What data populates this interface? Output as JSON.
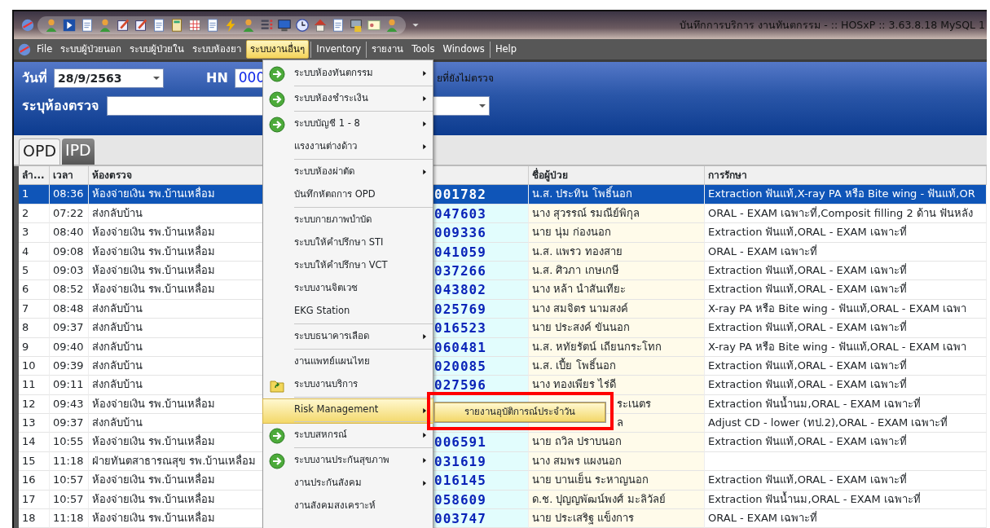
{
  "window": {
    "title": "บันทึกการบริการ งานทันตกรรม - :: HOSxP :: 3.63.8.18 MySQL 1"
  },
  "menubar": [
    {
      "label": "File",
      "selected": false
    },
    {
      "label": "ระบบผู้ป่วยนอก",
      "selected": false
    },
    {
      "label": "ระบบผู้ป่วยใน",
      "selected": false
    },
    {
      "label": "ระบบห้องยา",
      "selected": false
    },
    {
      "label": "ระบบงานอื่นๆ",
      "selected": true
    },
    {
      "label": "Inventory",
      "selected": false
    },
    {
      "label": "รายงาน",
      "selected": false
    },
    {
      "label": "Tools",
      "selected": false
    },
    {
      "label": "Windows",
      "selected": false
    },
    {
      "label": "Help",
      "selected": false
    }
  ],
  "header": {
    "date_label": "วันที่",
    "date_value": "28/9/2563",
    "hn_label": "HN",
    "hn_value": "000",
    "note": "ยที่ยังไม่ตรวจ",
    "room_label": "ระบุห้องตรวจ"
  },
  "tabs": [
    {
      "label": "OPD",
      "selected": true
    },
    {
      "label": "IPD",
      "selected": false
    }
  ],
  "table": {
    "columns": [
      "ลำ...",
      "เวลา",
      "ห้องตรวจ",
      "ชื่อผู้ป่วย",
      "การรักษา"
    ],
    "rows": [
      {
        "no": "1",
        "time": "08:36",
        "room": "ห้องจ่ายเงิน รพ.บ้านเหลื่อม",
        "hn": "001782",
        "name": "น.ส. ประทิน โพธิ์นอก",
        "treatment": "Extraction ฟันแท้,X-ray PA หรือ Bite wing - ฟันแท้,OR",
        "selected": true
      },
      {
        "no": "2",
        "time": "07:22",
        "room": "ส่งกลับบ้าน",
        "hn": "047603",
        "name": "นาง สุวรรณ์ รมณีย์พิกุล",
        "treatment": "ORAL - EXAM เฉพาะที่,Composit filling 2 ด้าน ฟันหลัง",
        "selected": false
      },
      {
        "no": "3",
        "time": "08:40",
        "room": "ห้องจ่ายเงิน รพ.บ้านเหลื่อม",
        "hn": "009336",
        "name": "นาย นุ่ม ก่องนอก",
        "treatment": "Extraction ฟันแท้,ORAL - EXAM เฉพาะที่",
        "selected": false
      },
      {
        "no": "4",
        "time": "09:08",
        "room": "ห้องจ่ายเงิน รพ.บ้านเหลื่อม",
        "hn": "041059",
        "name": "น.ส. แพรว ทองสาย",
        "treatment": "ORAL - EXAM เฉพาะที่",
        "selected": false
      },
      {
        "no": "5",
        "time": "09:03",
        "room": "ห้องจ่ายเงิน รพ.บ้านเหลื่อม",
        "hn": "037266",
        "name": "น.ส. ศิวภา เกษเกษี",
        "treatment": "Extraction ฟันแท้,ORAL - EXAM เฉพาะที่",
        "selected": false
      },
      {
        "no": "6",
        "time": "08:52",
        "room": "ห้องจ่ายเงิน รพ.บ้านเหลื่อม",
        "hn": "043802",
        "name": "นาง หล้า นำสันเทียะ",
        "treatment": "Extraction ฟันแท้,ORAL - EXAM เฉพาะที่",
        "selected": false
      },
      {
        "no": "7",
        "time": "08:48",
        "room": "ส่งกลับบ้าน",
        "hn": "025769",
        "name": "นาง สมจิตร นามสงค์",
        "treatment": "X-ray PA หรือ Bite wing - ฟันแท้,ORAL - EXAM เฉพา",
        "selected": false
      },
      {
        "no": "8",
        "time": "09:37",
        "room": "ส่งกลับบ้าน",
        "hn": "016523",
        "name": "นาย ประสงค์ ขันนอก",
        "treatment": "Extraction ฟันแท้,ORAL - EXAM เฉพาะที่",
        "selected": false
      },
      {
        "no": "9",
        "time": "09:40",
        "room": "ส่งกลับบ้าน",
        "hn": "060481",
        "name": "น.ส. หทัยรัตน์ เถียนกระโทก",
        "treatment": "X-ray PA หรือ Bite wing - ฟันแท้,ORAL - EXAM เฉพา",
        "selected": false
      },
      {
        "no": "10",
        "time": "09:39",
        "room": "ส่งกลับบ้าน",
        "hn": "020085",
        "name": "น.ส. เปี้ย โพธิ์นอก",
        "treatment": "Extraction ฟันแท้,ORAL - EXAM เฉพาะที่",
        "selected": false
      },
      {
        "no": "11",
        "time": "09:11",
        "room": "ส่งกลับบ้าน",
        "hn": "027596",
        "name": "นาง ทองเพียร ไร่ดี",
        "treatment": "Extraction ฟันแท้,ORAL - EXAM เฉพาะที่",
        "selected": false
      },
      {
        "no": "12",
        "time": "09:43",
        "room": "ห้องจ่ายเงิน รพ.บ้านเหลื่อม",
        "name": "ระเนตร",
        "treatment": "Extraction ฟันน้ำนม,ORAL - EXAM เฉพาะที่",
        "selected": false
      },
      {
        "no": "13",
        "time": "09:37",
        "room": "ส่งกลับบ้าน",
        "name": "ล",
        "treatment": "Adjust CD - lower (ทป.2),ORAL - EXAM เฉพาะที่",
        "selected": false
      },
      {
        "no": "14",
        "time": "10:55",
        "room": "ห้องจ่ายเงิน รพ.บ้านเหลื่อม",
        "hn": "006591",
        "name": "นาย ถวิล ปราบนอก",
        "treatment": "Extraction ฟันแท้,ORAL - EXAM เฉพาะที่",
        "selected": false
      },
      {
        "no": "15",
        "time": "11:18",
        "room": "ฝ่ายทันตสาธารณสุข รพ.บ้านเหลื่อม",
        "hn": "031619",
        "name": "นาง สมพร แผงนอก",
        "selected": false
      },
      {
        "no": "16",
        "time": "10:57",
        "room": "ห้องจ่ายเงิน รพ.บ้านเหลื่อม",
        "hn": "016145",
        "name": "นาย บานเย็น ระหาญนอก",
        "treatment": "Extraction ฟันแท้,ORAL - EXAM เฉพาะที่",
        "selected": false
      },
      {
        "no": "17",
        "time": "10:57",
        "room": "ห้องจ่ายเงิน รพ.บ้านเหลื่อม",
        "hn": "058609",
        "name": "ด.ช. ปุญญพัฒน์พงศ์ มะลิวัลย์",
        "treatment": "Extraction ฟันน้ำนม,ORAL - EXAM เฉพาะที่",
        "selected": false
      },
      {
        "no": "18",
        "time": "11:18",
        "room": "ห้องจ่ายเงิน รพ.บ้านเหลื่อม",
        "hn": "003747",
        "name": "นาย ประเสริฐ แข็งการ",
        "treatment": "ORAL - EXAM เฉพาะที่",
        "selected": false
      }
    ]
  },
  "menu": {
    "items": [
      {
        "label": "ระบบห้องทันตกรรม",
        "kind": "arrow",
        "submenu": true,
        "separator_after": true,
        "selected": false
      },
      {
        "label": "ระบบห้องชำระเงิน",
        "kind": "arrow",
        "submenu": true,
        "separator_after": true,
        "selected": false
      },
      {
        "label": "ระบบบัญชี 1 - 8",
        "kind": "arrow",
        "submenu": true,
        "separator_after": false,
        "selected": false
      },
      {
        "label": "แรงงานต่างด้าว",
        "submenu": true,
        "separator_after": true,
        "selected": false
      },
      {
        "label": "ระบบห้องผ่าตัด",
        "submenu": true,
        "separator_after": false,
        "selected": false
      },
      {
        "label": "บันทึกหัตถการ OPD",
        "submenu": false,
        "separator_after": true,
        "selected": false
      },
      {
        "label": "ระบบกายภาพบำบัด",
        "submenu": false,
        "separator_after": false,
        "selected": false
      },
      {
        "label": "ระบบให้คำปรึกษา STI",
        "submenu": false,
        "separator_after": false,
        "selected": false
      },
      {
        "label": "ระบบให้คำปรึกษา VCT",
        "submenu": false,
        "separator_after": false,
        "selected": false
      },
      {
        "label": "ระบบงานจิตเวช",
        "submenu": false,
        "separator_after": false,
        "selected": false
      },
      {
        "label": "EKG Station",
        "submenu": false,
        "separator_after": true,
        "selected": false
      },
      {
        "label": "ระบบธนาคารเลือด",
        "submenu": true,
        "separator_after": true,
        "selected": false
      },
      {
        "label": "งานแพทย์แผนไทย",
        "submenu": false,
        "separator_after": false,
        "selected": false
      },
      {
        "label": "ระบบงานบริการ",
        "kind": "folder",
        "submenu": false,
        "separator_after": true,
        "selected": false
      },
      {
        "label": "Risk Management",
        "submenu": true,
        "separator_after": true,
        "selected": true
      },
      {
        "label": "ระบบสหกรณ์",
        "kind": "arrow",
        "submenu": true,
        "separator_after": true,
        "selected": false
      },
      {
        "label": "ระบบงานประกันสุขภาพ",
        "kind": "arrow",
        "submenu": true,
        "separator_after": false,
        "selected": false
      },
      {
        "label": "งานประกันสังคม",
        "submenu": true,
        "separator_after": false,
        "selected": false
      },
      {
        "label": "งานสังคมสงเคราะห์",
        "submenu": false,
        "separator_after": false,
        "selected": false
      }
    ]
  },
  "submenu": {
    "items": [
      {
        "label": "รายงานอุบัติการณ์ประจำวัน",
        "selected": true
      }
    ]
  }
}
